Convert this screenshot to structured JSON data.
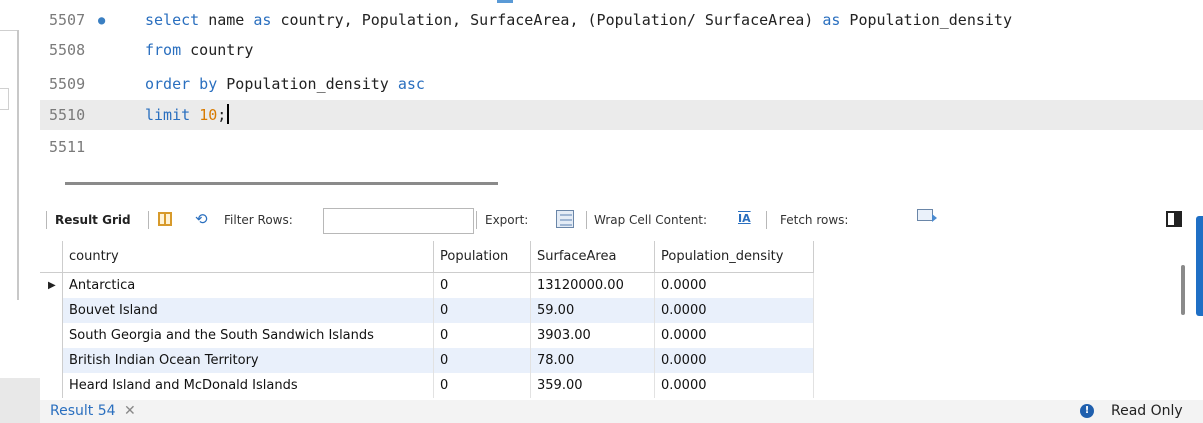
{
  "editor": {
    "lines": [
      {
        "number": "5507",
        "text_parts": [
          "select",
          " name ",
          "as",
          " country, Population, SurfaceArea, (Population/ SurfaceArea) ",
          "as",
          " Population_density"
        ]
      },
      {
        "number": "5508",
        "text_parts": [
          "from",
          " country"
        ]
      },
      {
        "number": "5509",
        "text_parts": [
          "order by",
          " Population_density ",
          "asc"
        ]
      },
      {
        "number": "5510",
        "text_parts": [
          "limit",
          " ",
          "10",
          ";"
        ]
      },
      {
        "number": "5511",
        "text_parts": []
      }
    ],
    "current_line": "5510"
  },
  "toolbar": {
    "result_grid_label": "Result Grid",
    "filter_rows_label": "Filter Rows:",
    "filter_rows_value": "",
    "export_label": "Export:",
    "wrap_cell_label": "Wrap Cell Content:",
    "wrap_icon_text": "IA",
    "fetch_rows_label": "Fetch rows:"
  },
  "grid": {
    "columns": [
      "country",
      "Population",
      "SurfaceArea",
      "Population_density"
    ],
    "rows": [
      {
        "country": "Antarctica",
        "Population": "0",
        "SurfaceArea": "13120000.00",
        "Population_density": "0.0000"
      },
      {
        "country": "Bouvet Island",
        "Population": "0",
        "SurfaceArea": "59.00",
        "Population_density": "0.0000"
      },
      {
        "country": "South Georgia and the South Sandwich Islands",
        "Population": "0",
        "SurfaceArea": "3903.00",
        "Population_density": "0.0000"
      },
      {
        "country": "British Indian Ocean Territory",
        "Population": "0",
        "SurfaceArea": "78.00",
        "Population_density": "0.0000"
      },
      {
        "country": "Heard Island and McDonald Islands",
        "Population": "0",
        "SurfaceArea": "359.00",
        "Population_density": "0.0000"
      }
    ],
    "selected_row_indicator": "▶"
  },
  "status": {
    "result_tab_label": "Result 54",
    "close_symbol": "✕",
    "info_symbol": "!",
    "read_only_label": "Read Only"
  },
  "colors": {
    "keyword": "#2a6fbf",
    "number": "#d87a00",
    "alt_row": "#e9f0fb",
    "accent_blue": "#1f6fc5"
  }
}
